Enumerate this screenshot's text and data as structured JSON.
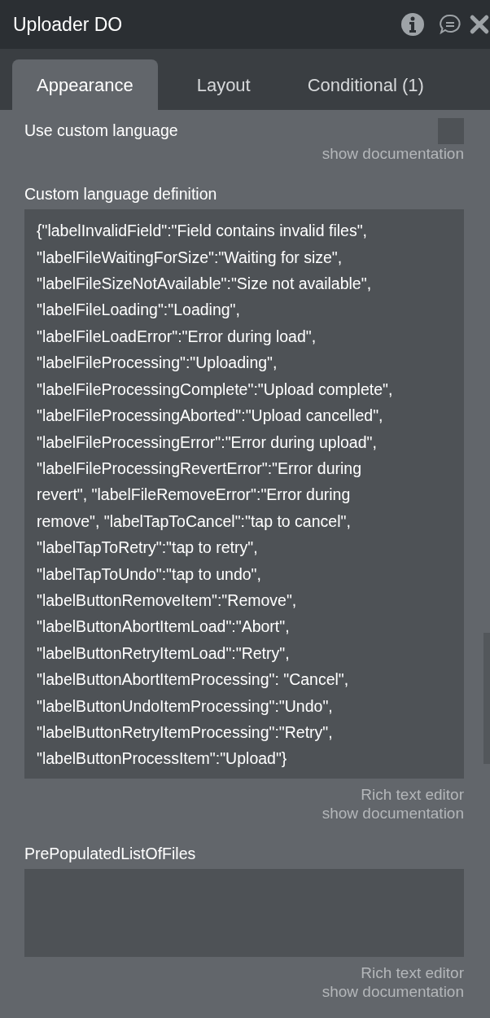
{
  "window": {
    "title": "Uploader DO"
  },
  "tabs": [
    {
      "label": "Appearance",
      "selected": true
    },
    {
      "label": "Layout",
      "selected": false
    },
    {
      "label": "Conditional (1)",
      "selected": false
    }
  ],
  "fields": [
    {
      "kind": "checkbox",
      "label": "Use custom language",
      "checked": false,
      "links": [
        "show documentation"
      ]
    },
    {
      "kind": "textarea",
      "label": "Custom language definition",
      "value": "{\"labelInvalidField\":\"Field contains invalid files\",\n\"labelFileWaitingForSize\":\"Waiting for size\",\n\"labelFileSizeNotAvailable\":\"Size not available\",\n\"labelFileLoading\":\"Loading\",\n\"labelFileLoadError\":\"Error during load\",\n\"labelFileProcessing\":\"Uploading\",\n\"labelFileProcessingComplete\":\"Upload complete\",\n\"labelFileProcessingAborted\":\"Upload cancelled\",\n\"labelFileProcessingError\":\"Error during upload\",\n\"labelFileProcessingRevertError\":\"Error during\nrevert\", \"labelFileRemoveError\":\"Error during\nremove\", \"labelTapToCancel\":\"tap to cancel\",\n\"labelTapToRetry\":\"tap to retry\",\n\"labelTapToUndo\":\"tap to undo\",\n\"labelButtonRemoveItem\":\"Remove\",\n\"labelButtonAbortItemLoad\":\"Abort\",\n\"labelButtonRetryItemLoad\":\"Retry\",\n\"labelButtonAbortItemProcessing\": \"Cancel\",\n\"labelButtonUndoItemProcessing\":\"Undo\",\n\"labelButtonRetryItemProcessing\":\"Retry\",\n\"labelButtonProcessItem\":\"Upload\"}",
      "links": [
        "Rich text editor",
        "show documentation"
      ]
    },
    {
      "kind": "textarea",
      "label": "PrePopulatedListOfFiles",
      "links": [
        "Rich text editor",
        "show documentation"
      ]
    }
  ]
}
